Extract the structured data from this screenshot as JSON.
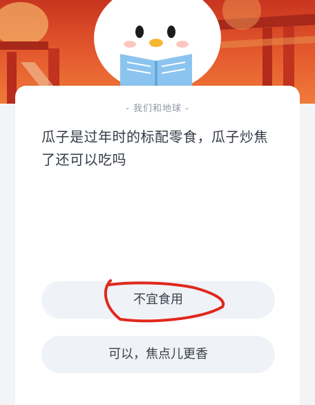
{
  "quiz": {
    "topic": "- 我们和地球 -",
    "question": "瓜子是过年时的标配零食，瓜子炒焦了还可以吃吗",
    "options": [
      {
        "label": "不宜食用"
      },
      {
        "label": "可以，焦点儿更香"
      }
    ]
  },
  "colors": {
    "banner_red": "#c8341e",
    "banner_orange": "#f07b3a",
    "annotation_red": "#e0281c",
    "option_bg": "#eff2f6"
  },
  "icons": {
    "mascot": "penguin-reading-icon"
  }
}
